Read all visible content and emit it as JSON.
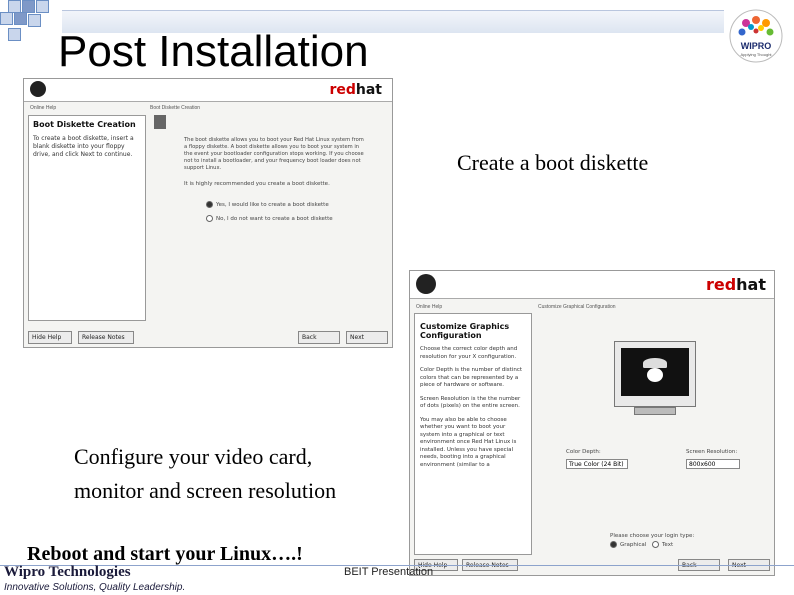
{
  "slide": {
    "title": "Post Installation",
    "caption_boot": "Create a boot diskette",
    "caption_video_1": "Configure your video card,",
    "caption_video_2": "monitor and screen resolution",
    "caption_reboot": "Reboot and start your Linux….!",
    "footer_company": "Wipro Technologies",
    "footer_tagline": "Innovative Solutions, Quality Leadership.",
    "footer_center": "BEIT Presentation",
    "logo_text": "WIPRO",
    "logo_sub": "Applying Thought"
  },
  "boot_window": {
    "brand_red": "red",
    "brand_hat": "hat",
    "help_pane_label": "Online Help",
    "main_pane_label": "Boot Diskette Creation",
    "help_title": "Boot Diskette Creation",
    "help_text": "To create a boot diskette, insert a blank diskette into your floppy drive, and click Next to continue.",
    "body_text": "The boot diskette allows you to boot your Red Hat Linux system from a floppy diskette. A boot diskette allows you to boot your system in the event your bootloader configuration stops working. If you choose not to install a bootloader, and your frequency boot loader does not support Linux.",
    "recommend_text": "It is highly recommended you create a boot diskette.",
    "option_yes": "Yes, I would like to create a boot diskette",
    "option_no": "No, I do not want to create a boot diskette",
    "hide_help": "Hide Help",
    "release_notes": "Release Notes",
    "back": "Back",
    "next": "Next"
  },
  "graphics_window": {
    "brand_red": "red",
    "brand_hat": "hat",
    "help_pane_label": "Online Help",
    "main_pane_label": "Customize Graphical Configuration",
    "help_title_1": "Customize Graphics",
    "help_title_2": "Configuration",
    "help_p1": "Choose the correct color depth and resolution for your X configuration.",
    "help_p2": "Color Depth is the number of distinct colors that can be represented by a piece of hardware or software.",
    "help_p3": "Screen Resolution is the the number of dots (pixels) on the entire screen.",
    "help_p4": "You may also be able to choose whether you want to boot your system into a graphical or text environment once Red Hat Linux is installed. Unless you have special needs, booting into a graphical environment (similar to a",
    "color_depth_label": "Color Depth:",
    "color_depth_value": "True Color (24 Bit)",
    "resolution_label": "Screen Resolution:",
    "resolution_value": "800x600",
    "login_label": "Please choose your login type:",
    "login_graphical": "Graphical",
    "login_text": "Text",
    "hide_help": "Hide Help",
    "release_notes": "Release Notes",
    "back": "Back",
    "next": "Next"
  }
}
